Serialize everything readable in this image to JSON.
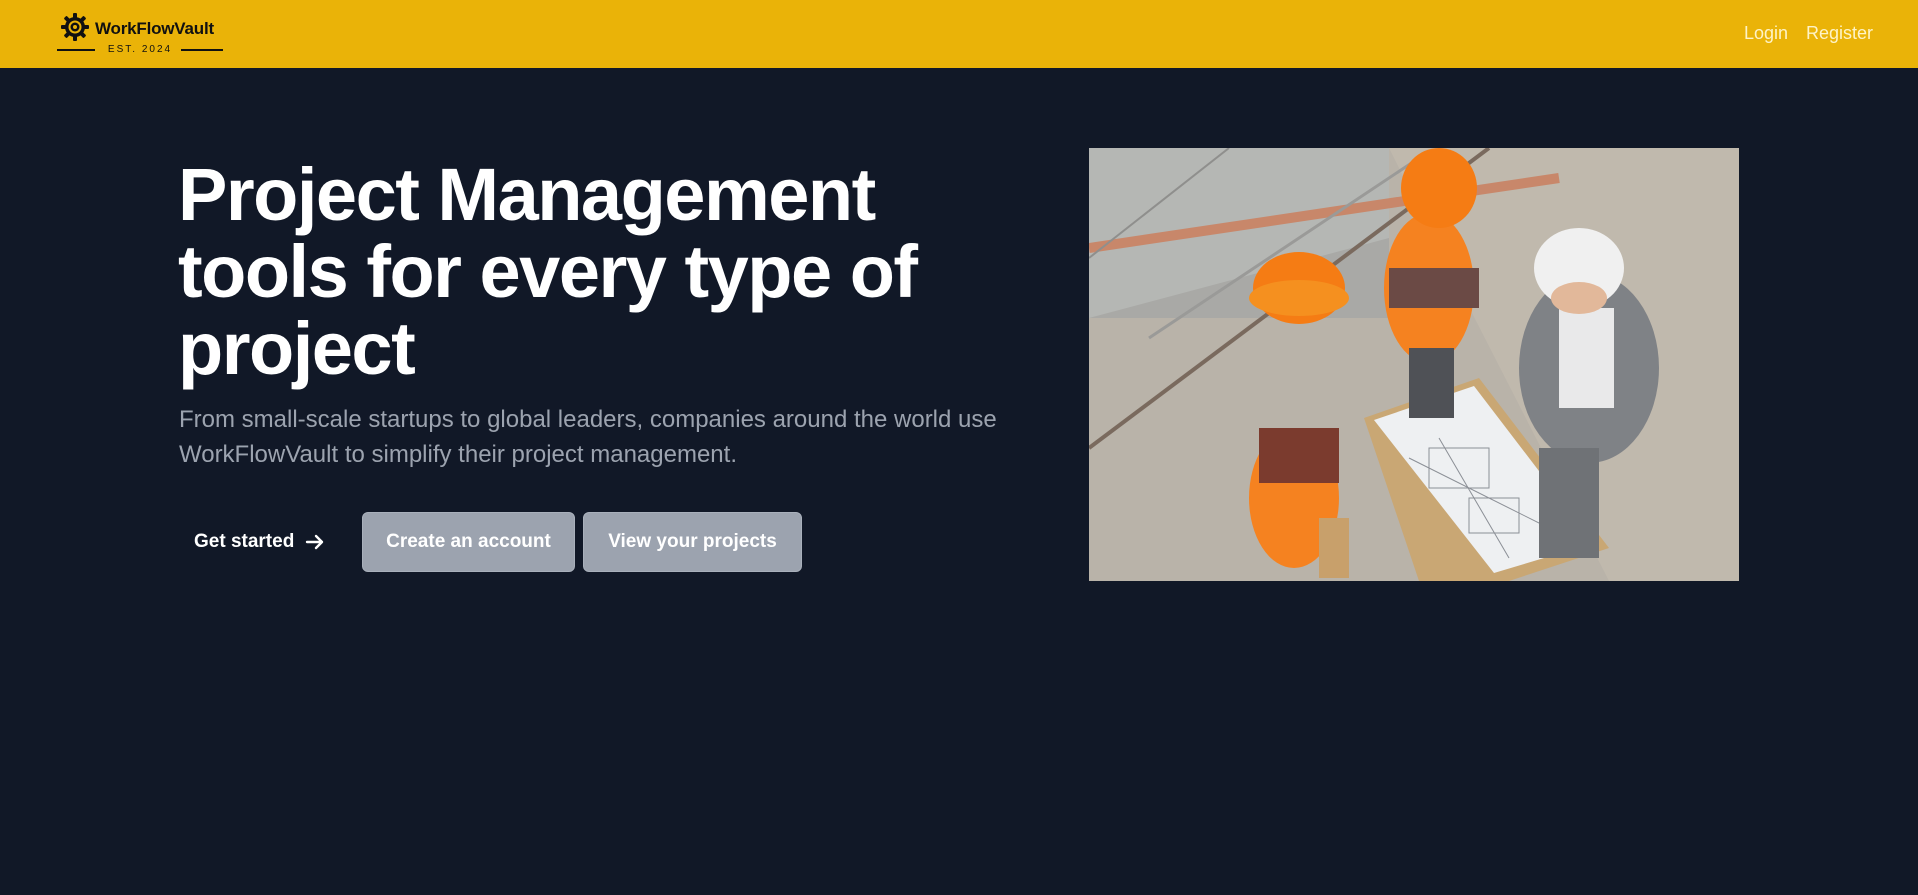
{
  "header": {
    "brand_name": "WorkFlowVault",
    "brand_tagline": "EST. 2024",
    "nav": {
      "login": "Login",
      "register": "Register"
    },
    "background_color": "#eab308"
  },
  "hero": {
    "title": "Project Management tools for every type of project",
    "subtitle": "From small-scale startups to global leaders, companies around the world use WorkFlowVault to simplify their project management.",
    "buttons": {
      "get_started": "Get started",
      "create_account": "Create an account",
      "view_projects": "View your projects"
    },
    "image_subject": "construction workers in hard hats reviewing blueprints"
  },
  "icons": {
    "logo": "gear-icon",
    "get_started": "arrow-right-icon"
  },
  "colors": {
    "page_background": "#111827",
    "title_text": "#ffffff",
    "subtitle_text": "#9ca3af",
    "secondary_button": "#9ca3af"
  }
}
